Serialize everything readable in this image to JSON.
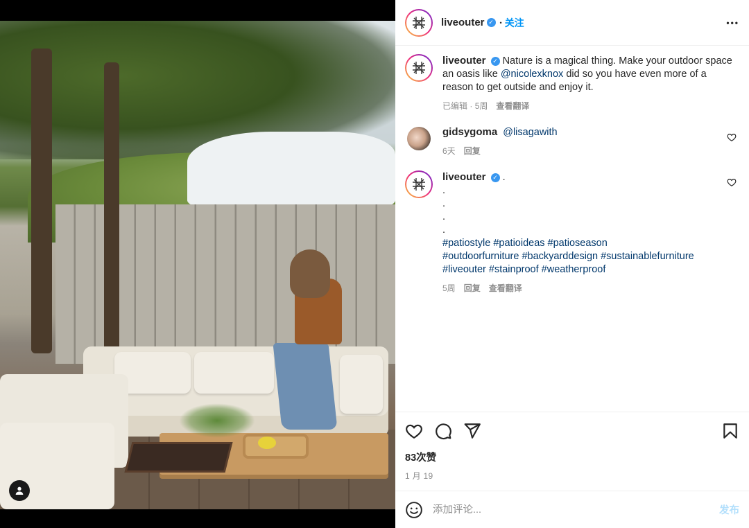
{
  "header": {
    "username": "liveouter",
    "verified_mark": "✓",
    "follow_label": "关注",
    "dot": "•",
    "more_label": "•••"
  },
  "caption": {
    "username": "liveouter",
    "text_before": "Nature is a magical thing. Make your outdoor space an oasis like ",
    "mention": "@nicolexknox",
    "text_after": " did so you have even more of a reason to get outside and enjoy it.",
    "meta_edited": "已编辑",
    "meta_sep": "·",
    "meta_time": "5周",
    "meta_translate": "查看翻译"
  },
  "comments": [
    {
      "username": "gidsygoma",
      "mention": "@lisagawith",
      "time": "6天",
      "reply": "回复"
    },
    {
      "username": "liveouter",
      "dots": [
        ".",
        ".",
        ".",
        ".",
        "."
      ],
      "tags_line1": "#patiostyle #patioideas #patioseason",
      "tags_line2": "#outdoorfurniture #backyarddesign #sustainablefurniture",
      "tags_line3": "#liveouter #stainproof #weatherproof",
      "time": "5周",
      "reply": "回复",
      "translate": "查看翻译"
    }
  ],
  "actions": {
    "likes": "83次赞",
    "date": "1 月 19"
  },
  "add_comment": {
    "placeholder": "添加评论...",
    "post_label": "发布"
  },
  "icons": {
    "avatar": "liveouter-logo-icon",
    "like": "heart-icon",
    "comment": "comment-icon",
    "share": "send-icon",
    "save": "bookmark-icon",
    "emoji": "emoji-icon",
    "user": "user-tag-icon"
  },
  "colors": {
    "accent": "#0095f6",
    "verified": "#3897f0",
    "link": "#00376b",
    "muted": "#8e8e8e",
    "post_disabled": "#b2dffc"
  }
}
